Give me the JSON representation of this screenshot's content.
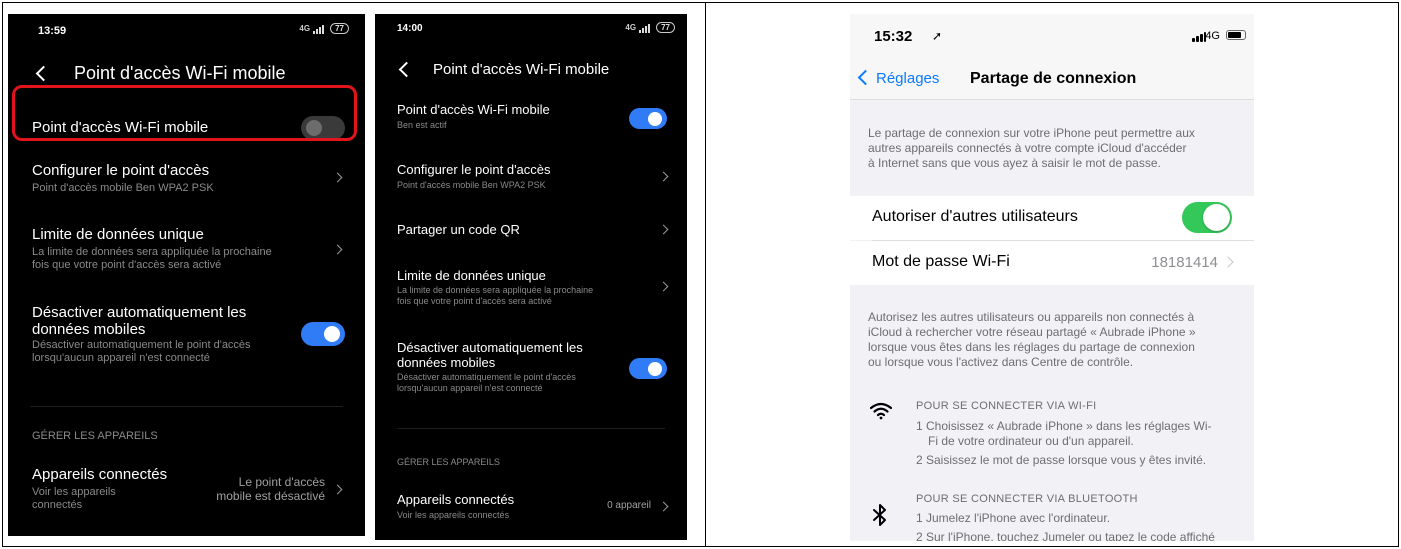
{
  "screen1": {
    "status": {
      "time": "13:59",
      "signal": "4G",
      "battery": "77"
    },
    "title": "Point d'accès Wi-Fi mobile",
    "hotspot": {
      "label": "Point d'accès Wi-Fi mobile",
      "enabled": false
    },
    "configure": {
      "title": "Configurer le point d'accès",
      "subtitle": "Point d'accès mobile Ben WPA2 PSK"
    },
    "limit": {
      "title": "Limite de données unique",
      "subtitle_line1": "La limite de données sera appliquée la prochaine",
      "subtitle_line2": "fois que votre point d'accès sera activé"
    },
    "auto_off": {
      "title_line1": "Désactiver automatiquement les",
      "title_line2": "données mobiles",
      "subtitle_line1": "Désactiver automatiquement le point d'accès",
      "subtitle_line2": "lorsqu'aucun appareil n'est connecté",
      "enabled": true
    },
    "section": "GÉRER LES APPAREILS",
    "devices": {
      "title": "Appareils connectés",
      "subtitle_line1": "Voir les appareils",
      "subtitle_line2": "connectés",
      "value_line1": "Le point d'accès",
      "value_line2": "mobile est désactivé"
    }
  },
  "screen2": {
    "status": {
      "time": "14:00",
      "signal": "4G",
      "battery": "77"
    },
    "title": "Point d'accès Wi-Fi mobile",
    "hotspot": {
      "label": "Point d'accès Wi-Fi mobile",
      "subtitle": "Ben est actif",
      "enabled": true
    },
    "configure": {
      "title": "Configurer le point d'accès",
      "subtitle": "Point d'accès mobile Ben WPA2 PSK"
    },
    "qr": {
      "title": "Partager un code QR"
    },
    "limit": {
      "title": "Limite de données unique",
      "subtitle_line1": "La limite de données sera appliquée la prochaine",
      "subtitle_line2": "fois que votre point d'accès sera activé"
    },
    "auto_off": {
      "title_line1": "Désactiver automatiquement les",
      "title_line2": "données mobiles",
      "subtitle_line1": "Désactiver automatiquement le point d'accès",
      "subtitle_line2": "lorsqu'aucun appareil n'est connecté",
      "enabled": true
    },
    "section": "GÉRER LES APPAREILS",
    "devices": {
      "title": "Appareils connectés",
      "subtitle": "Voir les appareils connectés",
      "value": "0 appareil"
    }
  },
  "ios": {
    "status": {
      "time": "15:32",
      "network": "4G"
    },
    "nav": {
      "back": "Réglages",
      "title": "Partage de connexion"
    },
    "intro_line1": "Le partage de connexion sur votre iPhone peut permettre aux",
    "intro_line2": "autres appareils connectés à votre compte iCloud d'accéder",
    "intro_line3": "à Internet sans que vous ayez à saisir le mot de passe.",
    "allow": {
      "label": "Autoriser d'autres utilisateurs",
      "enabled": true
    },
    "password": {
      "label": "Mot de passe Wi-Fi",
      "value": "18181414"
    },
    "info_line1": "Autorisez les autres utilisateurs ou appareils non connectés à",
    "info_line2": "iCloud à rechercher votre réseau partagé « Aubrade iPhone »",
    "info_line3": "lorsque vous êtes dans les réglages du partage de connexion",
    "info_line4": "ou lorsque vous l'activez dans Centre de contrôle.",
    "wifi": {
      "heading": "POUR SE CONNECTER VIA WI-FI",
      "step1_line1": "1 Choisissez « Aubrade iPhone » dans les réglages Wi-",
      "step1_line2": "Fi de votre ordinateur ou d'un appareil.",
      "step2": "2 Saisissez le mot de passe lorsque vous y êtes invité."
    },
    "bluetooth": {
      "heading": "POUR SE CONNECTER VIA BLUETOOTH",
      "step1": "1 Jumelez l'iPhone avec l'ordinateur.",
      "step2": "2 Sur l'iPhone, touchez Jumeler ou tapez le code affiché"
    }
  }
}
